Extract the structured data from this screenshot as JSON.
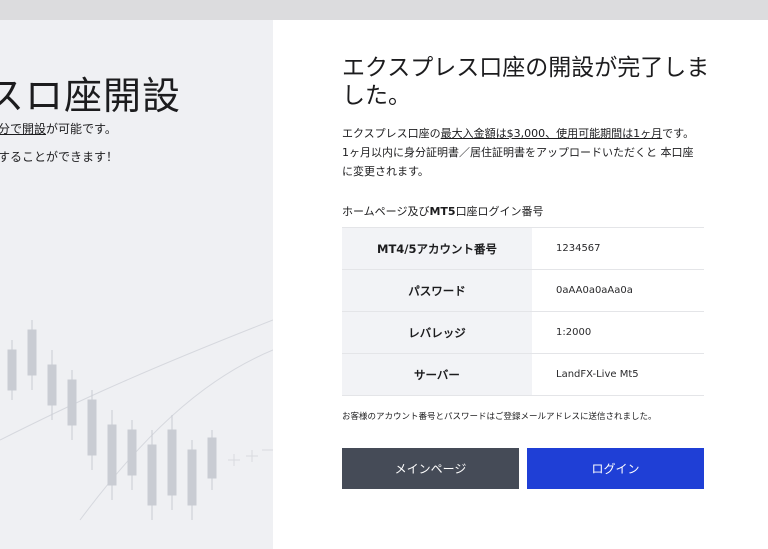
{
  "left_panel": {
    "title": "スロ座開設",
    "line1_underlined": "分で開設",
    "line1_rest": "が可能です。",
    "line2": "することができます！"
  },
  "content": {
    "heading": "エクスプレス口座の開設が完了しました。",
    "desc_prefix": "エクスプレス口座の",
    "desc_underlined": "最大入金額は$3,000、使用可能期間は1ヶ月",
    "desc_suffix": "です。",
    "desc_line2": "1ヶ月以内に身分証明書／居住証明書をアップロードいただくと 本口座に変更されます。",
    "section_title_prefix": "ホームページ及び",
    "section_title_bold": "MT5",
    "section_title_suffix": "口座ログイン番号",
    "rows": [
      {
        "label": "MT4/5アカウント番号",
        "value": "1234567"
      },
      {
        "label": "パスワード",
        "value": "0aAA0a0aAa0a"
      },
      {
        "label": "レバレッジ",
        "value": "1:2000"
      },
      {
        "label": "サーバー",
        "value": "LandFX-Live Mt5"
      }
    ],
    "note": "お客様のアカウント番号とパスワードはご登録メールアドレスに送信されました。",
    "main_button": "メインページ",
    "login_button": "ログイン"
  },
  "colors": {
    "login_button": "#1f3fd6",
    "main_button": "#454b57",
    "left_panel_bg": "#eff0f3"
  }
}
